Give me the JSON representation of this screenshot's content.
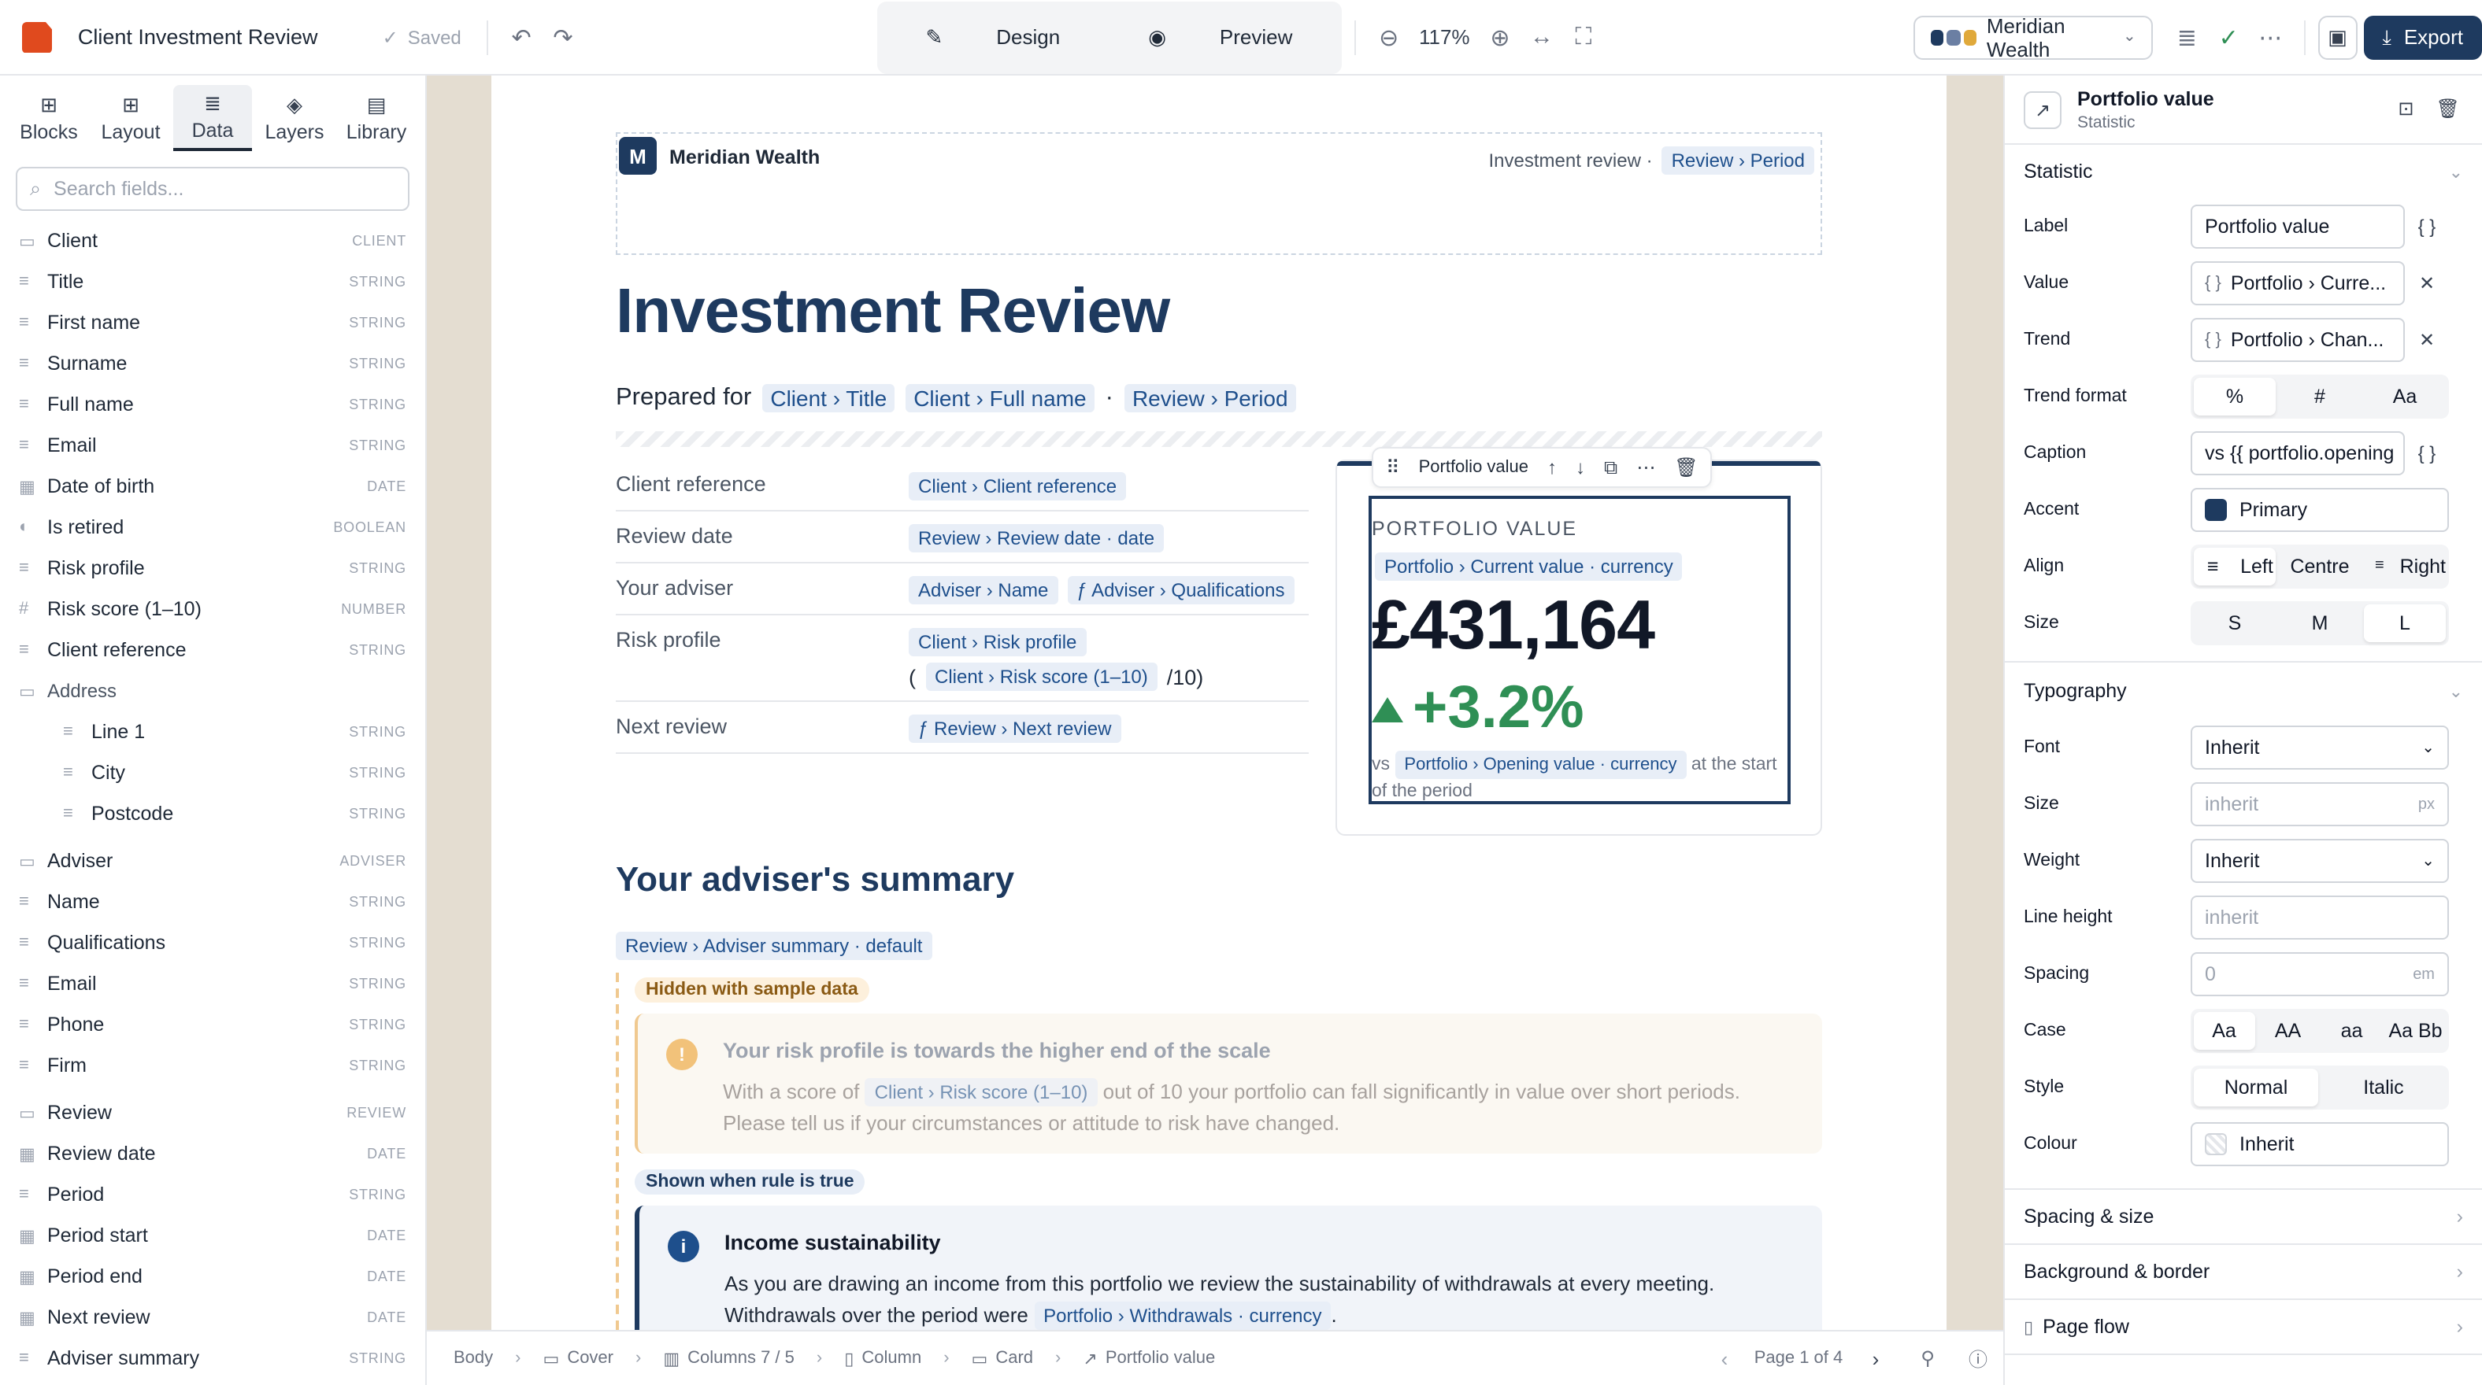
{
  "topbar": {
    "doc_title": "Client Investment Review",
    "saved": "Saved",
    "design": "Design",
    "preview": "Preview",
    "zoom": "117%",
    "brand": "Meridian Wealth",
    "export": "Export",
    "brand_colors": [
      "#1e3a5f",
      "#6b7fa3",
      "#e0a93b"
    ]
  },
  "left": {
    "tabs": [
      "Blocks",
      "Layout",
      "Data",
      "Layers",
      "Library"
    ],
    "search_placeholder": "Search fields...",
    "fields": [
      {
        "name": "Client",
        "type": "CLIENT",
        "icon": "folder-icon",
        "kind": "group"
      },
      {
        "name": "Title",
        "type": "STRING",
        "icon": "text-icon"
      },
      {
        "name": "First name",
        "type": "STRING",
        "icon": "text-icon"
      },
      {
        "name": "Surname",
        "type": "STRING",
        "icon": "text-icon"
      },
      {
        "name": "Full name",
        "type": "STRING",
        "icon": "text-icon"
      },
      {
        "name": "Email",
        "type": "STRING",
        "icon": "text-icon"
      },
      {
        "name": "Date of birth",
        "type": "DATE",
        "icon": "calendar-icon"
      },
      {
        "name": "Is retired",
        "type": "BOOLEAN",
        "icon": "toggle-icon"
      },
      {
        "name": "Risk profile",
        "type": "STRING",
        "icon": "text-icon"
      },
      {
        "name": "Risk score (1–10)",
        "type": "NUMBER",
        "icon": "hash-icon"
      },
      {
        "name": "Client reference",
        "type": "STRING",
        "icon": "text-icon"
      },
      {
        "name": "Address",
        "type": "",
        "icon": "folder-icon",
        "kind": "addr"
      },
      {
        "name": "Line 1",
        "type": "STRING",
        "icon": "text-icon",
        "kind": "sub"
      },
      {
        "name": "City",
        "type": "STRING",
        "icon": "text-icon",
        "kind": "sub"
      },
      {
        "name": "Postcode",
        "type": "STRING",
        "icon": "text-icon",
        "kind": "sub"
      },
      {
        "name": "Adviser",
        "type": "ADVISER",
        "icon": "folder-icon",
        "kind": "group"
      },
      {
        "name": "Name",
        "type": "STRING",
        "icon": "text-icon"
      },
      {
        "name": "Qualifications",
        "type": "STRING",
        "icon": "text-icon"
      },
      {
        "name": "Email",
        "type": "STRING",
        "icon": "text-icon"
      },
      {
        "name": "Phone",
        "type": "STRING",
        "icon": "text-icon"
      },
      {
        "name": "Firm",
        "type": "STRING",
        "icon": "text-icon"
      },
      {
        "name": "Review",
        "type": "REVIEW",
        "icon": "folder-icon",
        "kind": "group"
      },
      {
        "name": "Review date",
        "type": "DATE",
        "icon": "calendar-icon"
      },
      {
        "name": "Period",
        "type": "STRING",
        "icon": "text-icon"
      },
      {
        "name": "Period start",
        "type": "DATE",
        "icon": "calendar-icon"
      },
      {
        "name": "Period end",
        "type": "DATE",
        "icon": "calendar-icon"
      },
      {
        "name": "Next review",
        "type": "DATE",
        "icon": "calendar-icon"
      },
      {
        "name": "Adviser summary",
        "type": "STRING",
        "icon": "text-icon"
      }
    ]
  },
  "page": {
    "brand_initial": "M",
    "brand_name": "Meridian Wealth",
    "header_right": "Investment review ·",
    "header_token": "Review › Period",
    "title": "Investment Review",
    "prepared_for": "Prepared for",
    "prepared_tokens": [
      "Client › Title",
      "Client › Full name",
      "Review › Period"
    ],
    "details": [
      {
        "label": "Client reference",
        "tokens": [
          "Client › Client reference"
        ]
      },
      {
        "label": "Review date",
        "tokens": [
          "Review › Review date · date"
        ]
      },
      {
        "label": "Your adviser",
        "tokens": [
          "Adviser › Name",
          "ƒ Adviser › Qualifications"
        ]
      },
      {
        "label": "Risk profile",
        "tokens": [
          "Client › Risk profile"
        ],
        "line2_open": "(",
        "line2_token": "Client › Risk score (1–10)",
        "line2_close": "/10)"
      },
      {
        "label": "Next review",
        "tokens": [
          "ƒ Review › Next review"
        ]
      }
    ],
    "stat": {
      "toolbar_label": "Portfolio value",
      "label": "PORTFOLIO VALUE",
      "value_token": "Portfolio › Current value · currency",
      "value": "£431,164",
      "trend": "+3.2%",
      "caption_pre": "vs",
      "caption_token": "Portfolio › Opening value · currency",
      "caption_post": "at the start of the period"
    },
    "summary_title": "Your adviser's summary",
    "summary_token": "Review › Adviser summary · default",
    "hidden_pill": "Hidden with sample data",
    "warn_title": "Your risk profile is towards the higher end of the scale",
    "warn_pre": "With a score of",
    "warn_token": "Client › Risk score (1–10)",
    "warn_post": "out of 10 your portfolio can fall significantly in value over short periods. Please tell us if your circumstances or attitude to risk have changed.",
    "shown_pill": "Shown when rule is true",
    "info_title": "Income sustainability",
    "info_text": "As you are drawing an income from this portfolio we review the sustainability of withdrawals at every meeting. Withdrawals over the period were",
    "info_token": "Portfolio › Withdrawals · currency",
    "info_end": "."
  },
  "status": {
    "crumbs": [
      "Body",
      "Cover",
      "Columns 7 / 5",
      "Column",
      "Card",
      "Portfolio value"
    ],
    "page": "Page 1 of 4"
  },
  "right": {
    "title": "Portfolio value",
    "subtitle": "Statistic",
    "statistic_section": "Statistic",
    "label_label": "Label",
    "label_value": "Portfolio value",
    "value_label": "Value",
    "value_value": "Portfolio › Curre...",
    "trend_label": "Trend",
    "trend_value": "Portfolio › Chan...",
    "trend_format_label": "Trend format",
    "trend_format_options": [
      "%",
      "#",
      "Aa"
    ],
    "caption_label": "Caption",
    "caption_value": "vs {{ portfolio.opening",
    "accent_label": "Accent",
    "accent_value": "Primary",
    "accent_color": "#1e3a5f",
    "align_label": "Align",
    "align_options": [
      "Left",
      "Centre",
      "Right"
    ],
    "size_label": "Size",
    "size_options": [
      "S",
      "M",
      "L"
    ],
    "typography_section": "Typography",
    "font_label": "Font",
    "font_value": "Inherit",
    "tsize_label": "Size",
    "tsize_placeholder": "inherit",
    "tsize_unit": "px",
    "weight_label": "Weight",
    "weight_value": "Inherit",
    "lineheight_label": "Line height",
    "lineheight_placeholder": "inherit",
    "spacing_label": "Spacing",
    "spacing_placeholder": "0",
    "spacing_unit": "em",
    "case_label": "Case",
    "case_options": [
      "Aa",
      "AA",
      "aa",
      "Aa Bb"
    ],
    "style_label": "Style",
    "style_options": [
      "Normal",
      "Italic"
    ],
    "colour_label": "Colour",
    "colour_value": "Inherit",
    "spacing_size_section": "Spacing & size",
    "bg_border_section": "Background & border",
    "page_flow_section": "Page flow"
  }
}
